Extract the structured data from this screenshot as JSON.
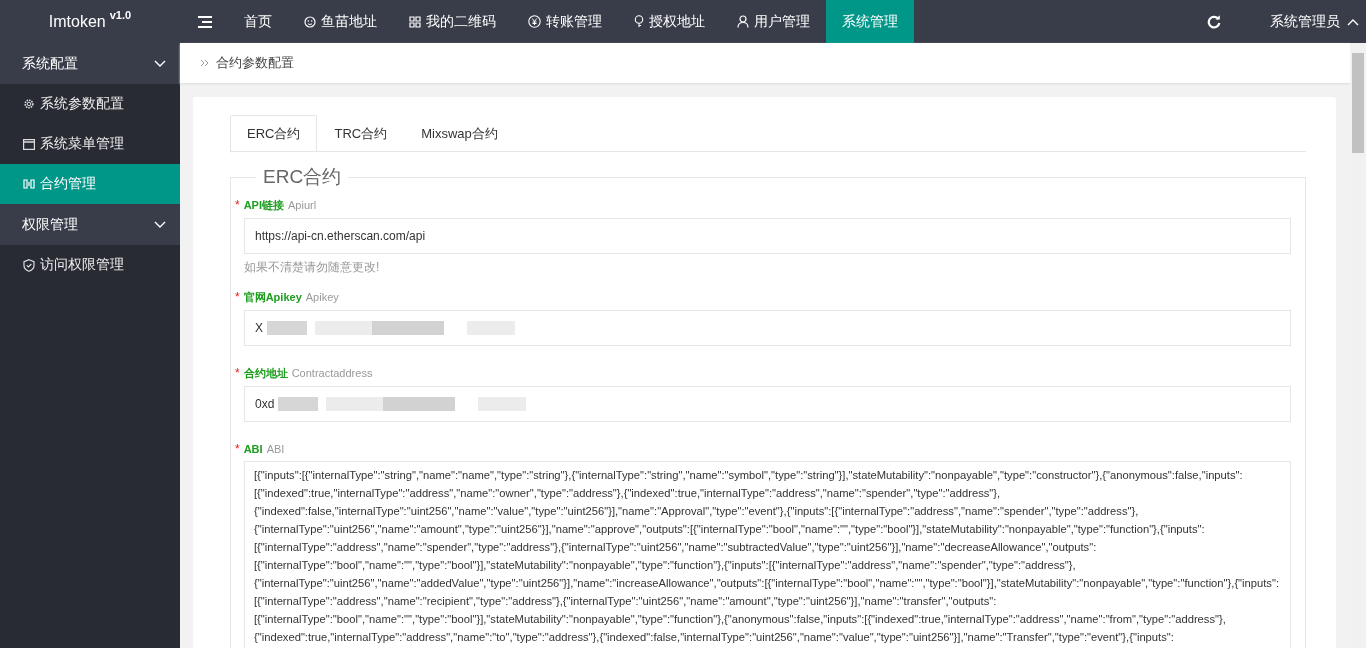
{
  "brand": {
    "name": "Imtoken",
    "version": "v1.0"
  },
  "top_nav": [
    {
      "label": "首页",
      "selected": false
    },
    {
      "label": "鱼苗地址",
      "selected": false
    },
    {
      "label": "我的二维码",
      "selected": false
    },
    {
      "label": "转账管理",
      "selected": false
    },
    {
      "label": "授权地址",
      "selected": false
    },
    {
      "label": "用户管理",
      "selected": false
    },
    {
      "label": "系统管理",
      "selected": true
    }
  ],
  "user_menu": {
    "label": "系统管理员",
    "expanded": true
  },
  "sidebar": [
    {
      "label": "系统配置",
      "expanded": true,
      "children": [
        {
          "label": "系统参数配置",
          "selected": false
        },
        {
          "label": "系统菜单管理",
          "selected": false
        },
        {
          "label": "合约管理",
          "selected": true
        }
      ]
    },
    {
      "label": "权限管理",
      "expanded": true,
      "children": [
        {
          "label": "访问权限管理",
          "selected": false
        }
      ]
    }
  ],
  "breadcrumb": "合约参数配置",
  "tabs": [
    {
      "label": "ERC合约",
      "selected": true
    },
    {
      "label": "TRC合约",
      "selected": false
    },
    {
      "label": "Mixswap合约",
      "selected": false
    }
  ],
  "section_title": "ERC合约",
  "fields": [
    {
      "label": "API链接",
      "hint": "Apiurl",
      "required_mark": "*",
      "value": "https://api-cn.etherscan.com/api",
      "redacted": false,
      "help": "如果不清楚请勿随意更改!"
    },
    {
      "label": "官网Apikey",
      "hint": "Apikey",
      "required_mark": "*",
      "value": "X",
      "redacted": true
    },
    {
      "label": "合约地址",
      "hint": "Contractaddress",
      "required_mark": "*",
      "value": "0xd",
      "redacted": true
    }
  ],
  "abi": {
    "label": "ABI",
    "hint": "ABI",
    "required_mark": "*",
    "lines": [
      "[{\"inputs\":[{\"internalType\":\"string\",\"name\":\"name\",\"type\":\"string\"},{\"internalType\":\"string\",\"name\":\"symbol\",\"type\":\"string\"}],\"stateMutability\":\"nonpayable\",\"type\":\"constructor\"},{\"anonymous\":false,\"inputs\":",
      "[{\"indexed\":true,\"internalType\":\"address\",\"name\":\"owner\",\"type\":\"address\"},{\"indexed\":true,\"internalType\":\"address\",\"name\":\"spender\",\"type\":\"address\"},",
      "{\"indexed\":false,\"internalType\":\"uint256\",\"name\":\"value\",\"type\":\"uint256\"}],\"name\":\"Approval\",\"type\":\"event\"},{\"inputs\":[{\"internalType\":\"address\",\"name\":\"spender\",\"type\":\"address\"},",
      "{\"internalType\":\"uint256\",\"name\":\"amount\",\"type\":\"uint256\"}],\"name\":\"approve\",\"outputs\":[{\"internalType\":\"bool\",\"name\":\"\",\"type\":\"bool\"}],\"stateMutability\":\"nonpayable\",\"type\":\"function\"},{\"inputs\":",
      "[{\"internalType\":\"address\",\"name\":\"spender\",\"type\":\"address\"},{\"internalType\":\"uint256\",\"name\":\"subtractedValue\",\"type\":\"uint256\"}],\"name\":\"decreaseAllowance\",\"outputs\":",
      "[{\"internalType\":\"bool\",\"name\":\"\",\"type\":\"bool\"}],\"stateMutability\":\"nonpayable\",\"type\":\"function\"},{\"inputs\":[{\"internalType\":\"address\",\"name\":\"spender\",\"type\":\"address\"},",
      "{\"internalType\":\"uint256\",\"name\":\"addedValue\",\"type\":\"uint256\"}],\"name\":\"increaseAllowance\",\"outputs\":[{\"internalType\":\"bool\",\"name\":\"\",\"type\":\"bool\"}],\"stateMutability\":\"nonpayable\",\"type\":\"function\"},{\"inputs\":",
      "[{\"internalType\":\"address\",\"name\":\"recipient\",\"type\":\"address\"},{\"internalType\":\"uint256\",\"name\":\"amount\",\"type\":\"uint256\"}],\"name\":\"transfer\",\"outputs\":",
      "[{\"internalType\":\"bool\",\"name\":\"\",\"type\":\"bool\"}],\"stateMutability\":\"nonpayable\",\"type\":\"function\"},{\"anonymous\":false,\"inputs\":[{\"indexed\":true,\"internalType\":\"address\",\"name\":\"from\",\"type\":\"address\"},",
      "{\"indexed\":true,\"internalType\":\"address\",\"name\":\"to\",\"type\":\"address\"},{\"indexed\":false,\"internalType\":\"uint256\",\"name\":\"value\",\"type\":\"uint256\"}],\"name\":\"Transfer\",\"type\":\"event\"},{\"inputs\":"
    ]
  }
}
